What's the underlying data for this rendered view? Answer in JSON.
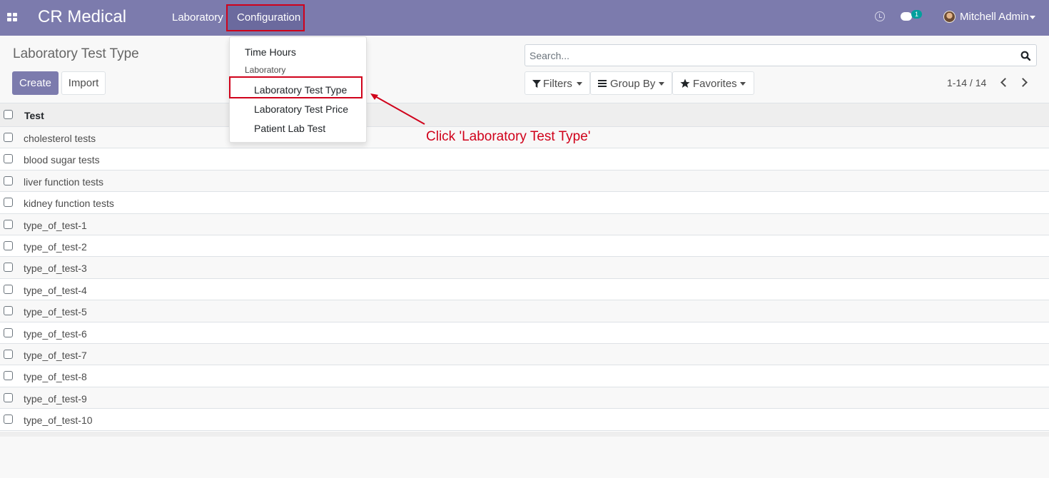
{
  "navbar": {
    "apps_icon": "grid-icon",
    "brand": "CR Medical",
    "menu": [
      {
        "label": "Laboratory"
      },
      {
        "label": "Configuration"
      }
    ],
    "chat_badge": "1",
    "user_name": "Mitchell Admin",
    "accent_color": "#7c7bad"
  },
  "dropdown": {
    "items": [
      {
        "label": "Time Hours"
      },
      {
        "label": "Laboratory"
      },
      {
        "label": "Laboratory Test Type"
      },
      {
        "label": "Laboratory Test Price"
      },
      {
        "label": "Patient Lab Test"
      }
    ]
  },
  "page": {
    "title": "Laboratory Test Type",
    "create_label": "Create",
    "import_label": "Import"
  },
  "search": {
    "placeholder": "Search...",
    "filters_label": "Filters",
    "groupby_label": "Group By",
    "favorites_label": "Favorites"
  },
  "pager": {
    "value": "1-14 / 14"
  },
  "table": {
    "column": "Test",
    "rows": [
      "cholesterol tests",
      "blood sugar tests",
      "liver function tests",
      "kidney function tests",
      "type_of_test-1",
      "type_of_test-2",
      "type_of_test-3",
      "type_of_test-4",
      "type_of_test-5",
      "type_of_test-6",
      "type_of_test-7",
      "type_of_test-8",
      "type_of_test-9",
      "type_of_test-10"
    ]
  },
  "annotation": {
    "text": "Click 'Laboratory Test Type'",
    "color": "#d0021b"
  }
}
